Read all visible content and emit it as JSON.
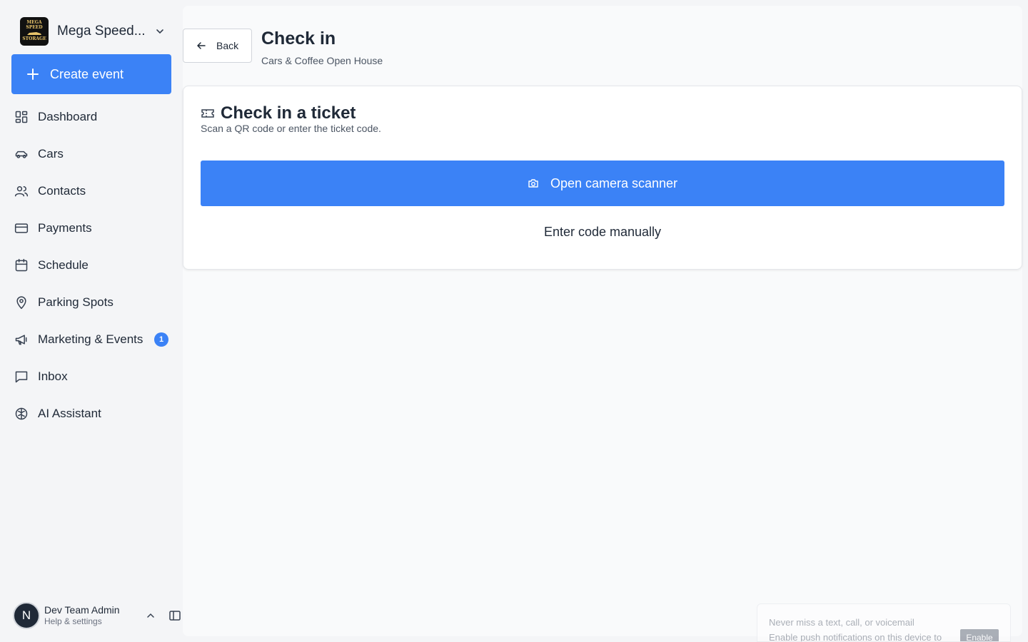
{
  "sidebar": {
    "org": {
      "name": "Mega Speed...",
      "logo_top": "MEGA SPEED",
      "logo_bottom": "STORAGE"
    },
    "create_label": "Create event",
    "items": [
      {
        "label": "Dashboard",
        "icon": "dashboard-icon"
      },
      {
        "label": "Cars",
        "icon": "car-icon"
      },
      {
        "label": "Contacts",
        "icon": "users-icon"
      },
      {
        "label": "Payments",
        "icon": "credit-card-icon"
      },
      {
        "label": "Schedule",
        "icon": "calendar-icon"
      },
      {
        "label": "Parking Spots",
        "icon": "map-pin-icon"
      },
      {
        "label": "Marketing & Events",
        "icon": "megaphone-icon",
        "badge": "1"
      },
      {
        "label": "Inbox",
        "icon": "message-square-icon"
      },
      {
        "label": "AI Assistant",
        "icon": "brain-icon"
      }
    ],
    "user": {
      "initial": "N",
      "name": "Dev Team Admin",
      "sub": "Help & settings"
    }
  },
  "header": {
    "back_label": "Back",
    "title": "Check in",
    "subtitle": "Cars & Coffee Open House"
  },
  "card": {
    "title": "Check in a ticket",
    "subtitle": "Scan a QR code or enter the ticket code.",
    "scan_label": "Open camera scanner",
    "manual_label": "Enter code manually"
  },
  "toast": {
    "title": "Never miss a text, call, or voicemail",
    "body": "Enable push notifications on this device to",
    "button": "Enable"
  },
  "colors": {
    "accent": "#3b82f6",
    "sidebar_bg": "#f4f5f7",
    "panel_bg": "#f9fafb"
  }
}
